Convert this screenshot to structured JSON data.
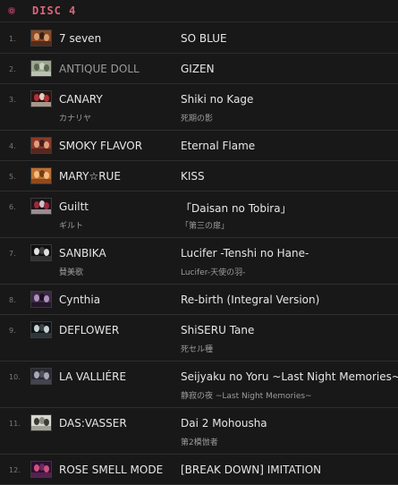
{
  "disc": {
    "title": "DISC 4",
    "icon": "disc-icon"
  },
  "tracks": [
    {
      "number": "1.",
      "artist": "7 seven",
      "artist_sub": "",
      "song": "SO BLUE",
      "song_sub": "",
      "thumb_colors": [
        "#8a4a2a",
        "#d6a070",
        "#3a2016"
      ],
      "dim": false
    },
    {
      "number": "2.",
      "artist": "ANTIQUE DOLL",
      "artist_sub": "",
      "song": "GIZEN",
      "song_sub": "",
      "thumb_colors": [
        "#9aa690",
        "#5a6450",
        "#c8d0c0"
      ],
      "dim": true
    },
    {
      "number": "3.",
      "artist": "CANARY",
      "artist_sub": "カナリヤ",
      "song": "Shiki no Kage",
      "song_sub": "死期の影",
      "thumb_colors": [
        "#2a1410",
        "#b0303a",
        "#e0d0c0"
      ],
      "dim": false
    },
    {
      "number": "4.",
      "artist": "SMOKY FLAVOR",
      "artist_sub": "",
      "song": "Eternal Flame",
      "song_sub": "",
      "thumb_colors": [
        "#8a3a2a",
        "#e0a080",
        "#40201a"
      ],
      "dim": false
    },
    {
      "number": "5.",
      "artist": "MARY☆RUE",
      "artist_sub": "",
      "song": "KISS",
      "song_sub": "",
      "thumb_colors": [
        "#c07030",
        "#f0c080",
        "#7a3a1a"
      ],
      "dim": false
    },
    {
      "number": "6.",
      "artist": "Guiltt",
      "artist_sub": "ギルト",
      "song": "「Daisan no Tobira」",
      "song_sub": "「第三の扉」",
      "thumb_colors": [
        "#1a1418",
        "#9a2a3a",
        "#d0c0c8"
      ],
      "dim": false
    },
    {
      "number": "7.",
      "artist": "SANBIKA",
      "artist_sub": "賛美歌",
      "song": "Lucifer -Tenshi no Hane-",
      "song_sub": "Lucifer-天使の羽-",
      "thumb_colors": [
        "#101010",
        "#e0e0e0",
        "#404040"
      ],
      "dim": false
    },
    {
      "number": "8.",
      "artist": "Cynthia",
      "artist_sub": "",
      "song": "Re-birth (Integral Version)",
      "song_sub": "",
      "thumb_colors": [
        "#3a2a40",
        "#b090c0",
        "#1a1020"
      ],
      "dim": false
    },
    {
      "number": "9.",
      "artist": "DEFLOWER",
      "artist_sub": "",
      "song": "ShiSERU Tane",
      "song_sub": "死セル種",
      "thumb_colors": [
        "#101418",
        "#c8d0d0",
        "#3a4448"
      ],
      "dim": false
    },
    {
      "number": "10.",
      "artist": "LA VALLIÉRE",
      "artist_sub": "",
      "song": "Seijyaku no Yoru ~Last Night Memories~",
      "song_sub": "静寂の夜 ~Last Night Memories~",
      "thumb_colors": [
        "#2a2a34",
        "#a8a8b8",
        "#50505c"
      ],
      "dim": false
    },
    {
      "number": "11.",
      "artist": "DAS:VASSER",
      "artist_sub": "",
      "song": "Dai 2 Mohousha",
      "song_sub": "第2模倣者",
      "thumb_colors": [
        "#d8d8d0",
        "#3a3a3a",
        "#8a8a80"
      ],
      "dim": false
    },
    {
      "number": "12.",
      "artist": "ROSE SMELL MODE",
      "artist_sub": "",
      "song": "[BREAK DOWN] IMITATION",
      "song_sub": "",
      "thumb_colors": [
        "#2a1030",
        "#d05080",
        "#6a2a60"
      ],
      "dim": false
    }
  ]
}
